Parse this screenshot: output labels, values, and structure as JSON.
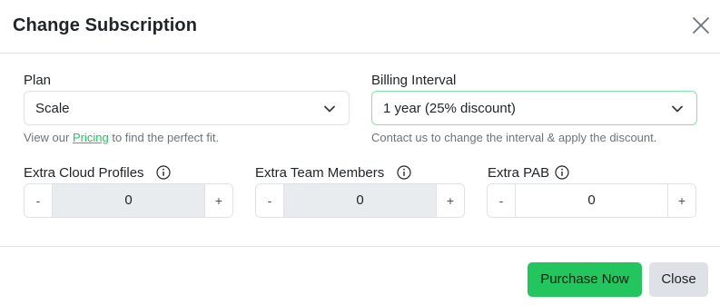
{
  "modal": {
    "title": "Change Subscription",
    "close_icon": "close-icon"
  },
  "plan": {
    "label": "Plan",
    "selected": "Scale",
    "help_prefix": "View our",
    "help_link": "Pricing",
    "help_suffix": "to find the perfect fit."
  },
  "billing": {
    "label": "Billing Interval",
    "selected": "1 year (25% discount)",
    "help": "Contact us to change the interval & apply the discount."
  },
  "extras": [
    {
      "label": "Extra Cloud Profiles",
      "value": "0",
      "minus": "-",
      "plus": "+"
    },
    {
      "label": "Extra Team Members",
      "value": "0",
      "minus": "-",
      "plus": "+"
    },
    {
      "label": "Extra PAB",
      "value": "0",
      "minus": "-",
      "plus": "+"
    }
  ],
  "footer": {
    "purchase_label": "Purchase Now",
    "close_label": "Close"
  },
  "colors": {
    "accent": "#22c55e",
    "secondary": "#dee2e6",
    "muted_text": "#6c757d"
  }
}
